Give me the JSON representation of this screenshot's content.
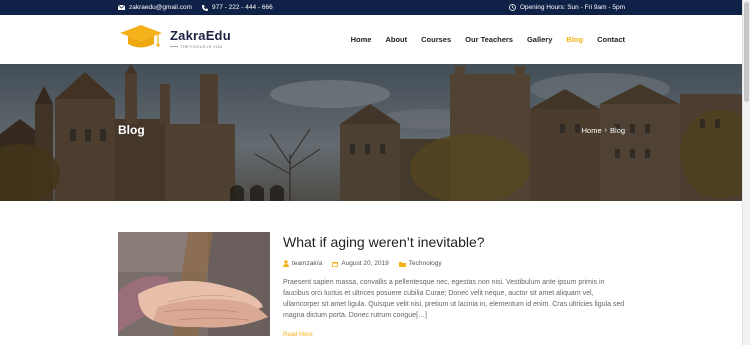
{
  "topbar": {
    "email": "zakraedu@gmail.com",
    "phone": "977 - 222 - 444 - 666",
    "hours": "Opening Hours:  Sun - Fri  9am - 5pm"
  },
  "logo": {
    "name": "ZakraEdu",
    "tagline": "THE FOCUS IS YOU"
  },
  "nav": {
    "items": [
      "Home",
      "About",
      "Courses",
      "Our Teachers",
      "Gallery",
      "Blog",
      "Contact"
    ],
    "active": "Blog"
  },
  "banner": {
    "title": "Blog",
    "breadcrumb": [
      "Home",
      "Blog"
    ]
  },
  "post": {
    "title": "What if aging weren’t inevitable?",
    "author": "teamzakra",
    "date": "August 20, 2019",
    "category": "Technology",
    "excerpt": "Praesent sapien massa, convallis a pellentesque nec, egestas non nisi. Vestibulum ante ipsum primis in faucibus orci luctus et ultrices posuere cubilia Curae; Donec velit neque, auctor sit amet aliquam vel, ullamcorper sit amet ligula. Quisque velit nisi, pretium ut lacinia in, elementum id enim. Cras ultricies ligula sed magna dictum porta. Donec rutrum congue[…]",
    "read_more": "Read More"
  },
  "colors": {
    "topbar": "#0f2147",
    "accent": "#f5b11a",
    "nav_text": "#222222"
  },
  "icons": [
    "envelope-icon",
    "phone-icon",
    "clock-icon",
    "graduation-cap-icon",
    "user-icon",
    "calendar-icon",
    "folder-icon"
  ]
}
